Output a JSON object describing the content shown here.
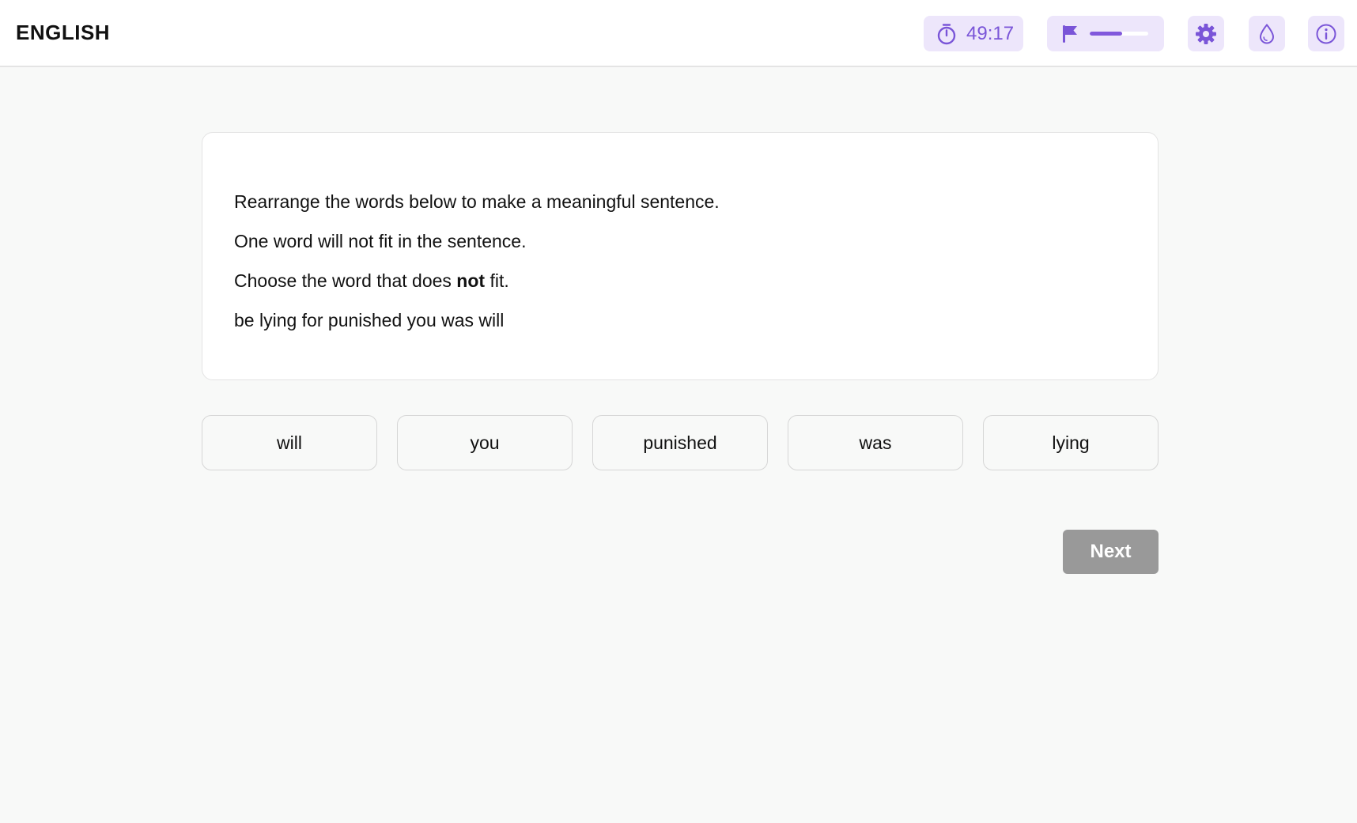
{
  "header": {
    "subject": "ENGLISH",
    "timer": "49:17",
    "progress_fraction": 0.55,
    "icons": [
      "stopwatch-icon",
      "flag-icon",
      "gear-icon",
      "droplet-icon",
      "info-icon"
    ],
    "accent_color": "#7a55d8",
    "tool_background": "#ede6fb"
  },
  "question": {
    "line1": "Rearrange the words below to make a meaningful sentence.",
    "line2": "One word will not fit in the sentence.",
    "line3_before": "Choose the word that does ",
    "line3_bold": "not",
    "line3_after": " fit.",
    "line4": "be lying for punished you was will"
  },
  "options": [
    "will",
    "you",
    "punished",
    "was",
    "lying"
  ],
  "next_label": "Next",
  "colors": {
    "next_button": "#999999",
    "page_background": "#f8f9f8"
  }
}
